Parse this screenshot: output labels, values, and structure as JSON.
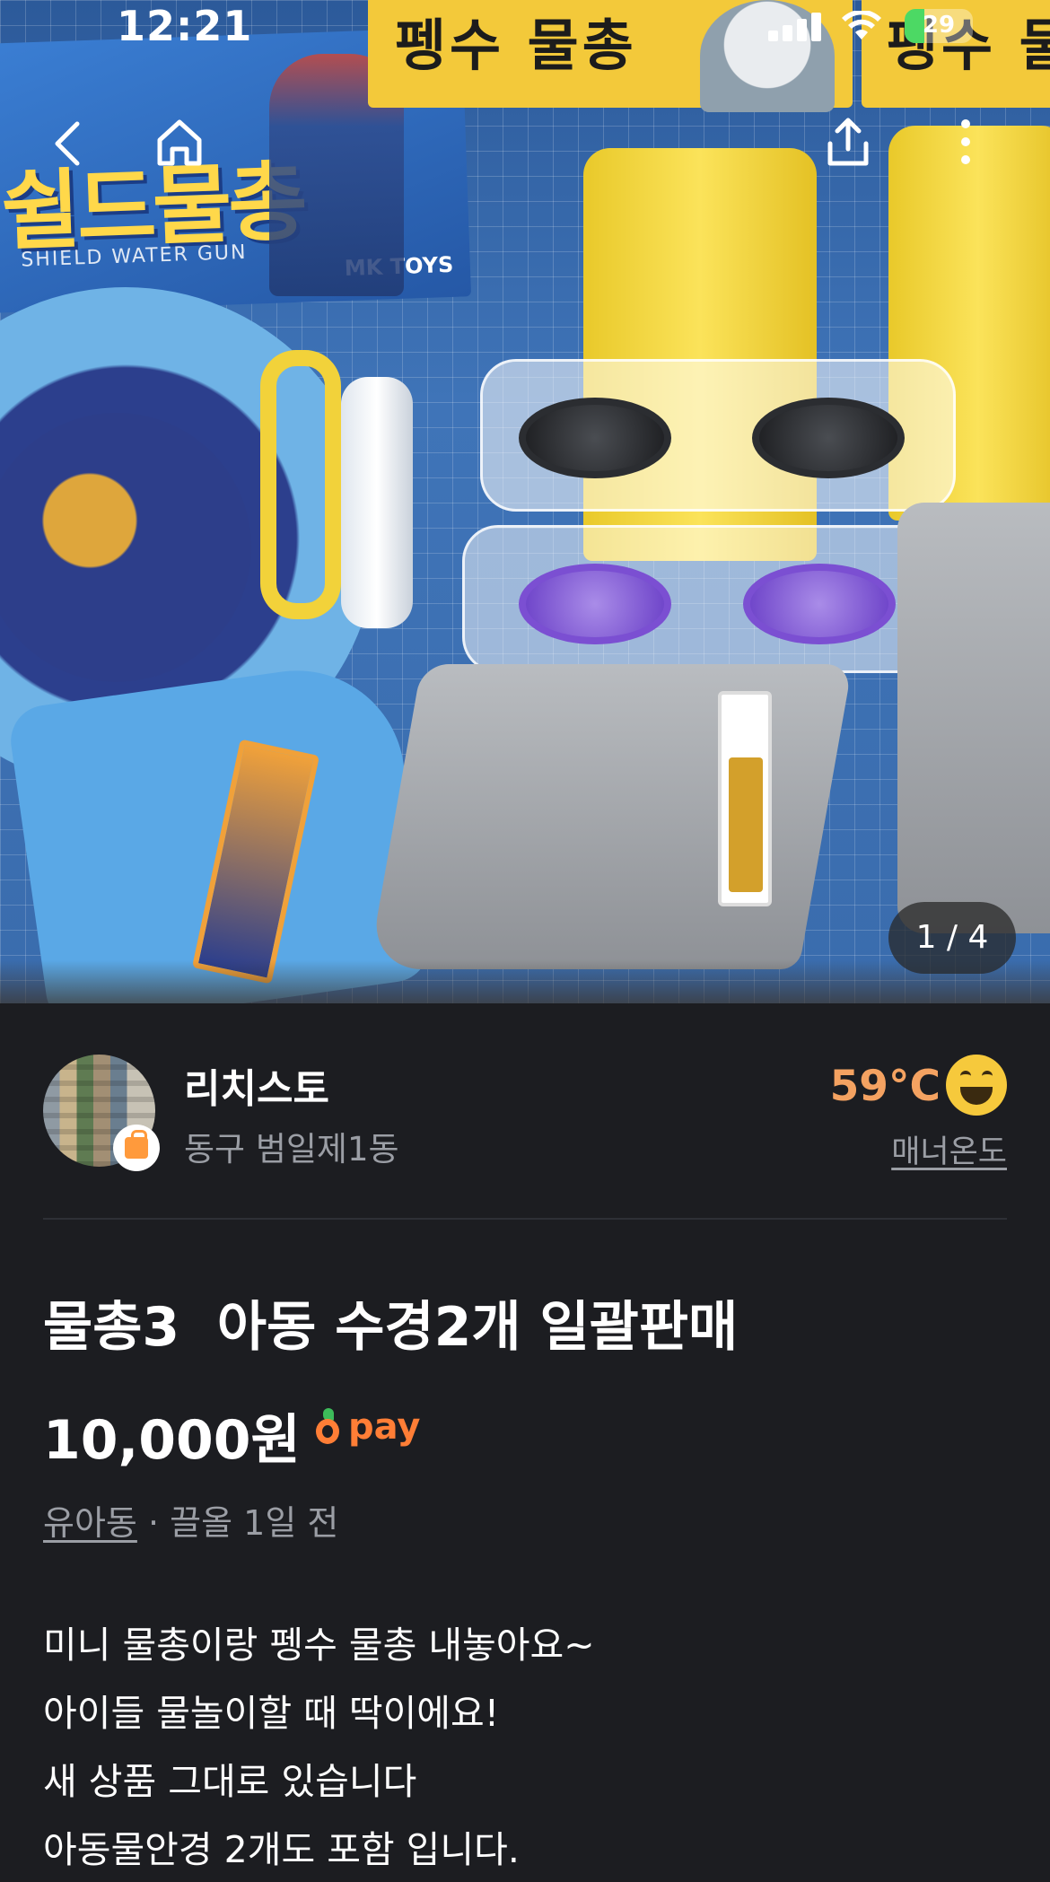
{
  "status_bar": {
    "time": "12:21",
    "battery": "29",
    "battery_level": 0.29,
    "battery_color": "#4cd964"
  },
  "photo": {
    "counter": "1 / 4",
    "current": 1,
    "total": 4,
    "package_left_title": "쉴드물총",
    "package_left_subtitle": "SHIELD WATER GUN",
    "package_left_brand": "MK TOYS",
    "package_right_title": "펭수 물총",
    "package_right_title_2": "펭수 물"
  },
  "nav": {
    "back_icon": "chevron-left-icon",
    "home_icon": "home-icon",
    "share_icon": "share-icon",
    "more_icon": "more-vertical-icon"
  },
  "seller": {
    "name": "리치스토",
    "location": "동구 범일제1동",
    "temperature": "59°C",
    "manner_label": "매너온도",
    "temperature_color": "#f4a261"
  },
  "listing": {
    "title": "물총3  아동 수경2개 일괄판매",
    "price": "10,000원",
    "pay_label": "pay",
    "category": "유아동",
    "separator": " · ",
    "time_ago": "끌올 1일 전",
    "description": [
      "미니 물총이랑 펭수 물총 내놓아요~",
      "아이들 물놀이할 때 딱이에요!",
      "새 상품 그대로 있습니다",
      "아동물안경 2개도 포함 입니다."
    ]
  },
  "colors": {
    "background": "#1c1d21",
    "accent": "#ff7e36",
    "muted_text": "#9b9ea5"
  }
}
